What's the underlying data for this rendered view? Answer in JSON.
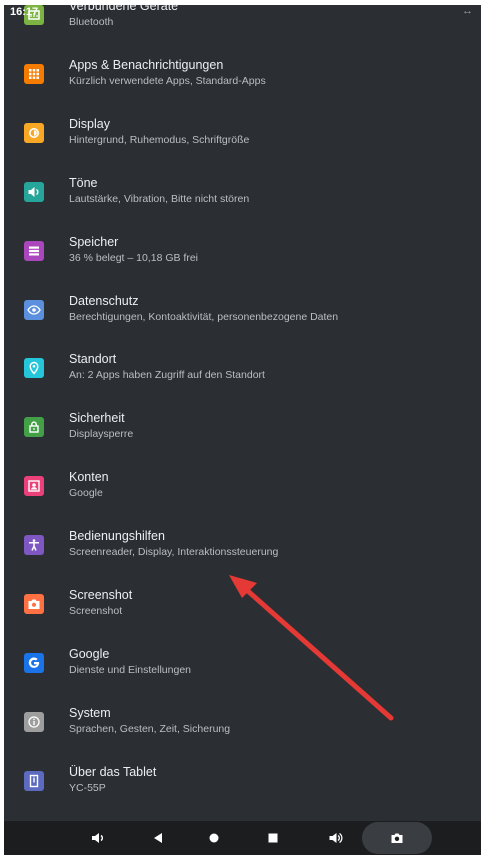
{
  "status_bar": {
    "time": "16:17",
    "rotate_icon": "↔"
  },
  "settings": [
    {
      "title": "Verbundene Geräte",
      "subtitle": "Bluetooth",
      "icon": "connected-devices-icon",
      "color": "#7cb342"
    },
    {
      "title": "Apps & Benachrichtigungen",
      "subtitle": "Kürzlich verwendete Apps, Standard-Apps",
      "icon": "apps-grid-icon",
      "color": "#f57c00"
    },
    {
      "title": "Display",
      "subtitle": "Hintergrund, Ruhemodus, Schriftgröße",
      "icon": "brightness-icon",
      "color": "#f9a825"
    },
    {
      "title": "Töne",
      "subtitle": "Lautstärke, Vibration, Bitte nicht stören",
      "icon": "volume-icon",
      "color": "#26a69a"
    },
    {
      "title": "Speicher",
      "subtitle": "36 % belegt – 10,18 GB frei",
      "icon": "storage-icon",
      "color": "#ab47bc"
    },
    {
      "title": "Datenschutz",
      "subtitle": "Berechtigungen, Kontoaktivität, personenbezogene Daten",
      "icon": "privacy-eye-icon",
      "color": "#5c8fde"
    },
    {
      "title": "Standort",
      "subtitle": "An: 2 Apps haben Zugriff auf den Standort",
      "icon": "location-pin-icon",
      "color": "#26c6da"
    },
    {
      "title": "Sicherheit",
      "subtitle": "Displaysperre",
      "icon": "lock-icon",
      "color": "#43a047"
    },
    {
      "title": "Konten",
      "subtitle": "Google",
      "icon": "account-icon",
      "color": "#ec407a"
    },
    {
      "title": "Bedienungshilfen",
      "subtitle": "Screenreader, Display, Interaktionssteuerung",
      "icon": "accessibility-icon",
      "color": "#7e57c2"
    },
    {
      "title": "Screenshot",
      "subtitle": "Screenshot",
      "icon": "camera-icon",
      "color": "#ff7043"
    },
    {
      "title": "Google",
      "subtitle": "Dienste und Einstellungen",
      "icon": "google-g-icon",
      "color": "#1a73e8"
    },
    {
      "title": "System",
      "subtitle": "Sprachen, Gesten, Zeit, Sicherung",
      "icon": "info-icon",
      "color": "#9e9e9e"
    },
    {
      "title": "Über das Tablet",
      "subtitle": "YC-55P",
      "icon": "tablet-icon",
      "color": "#5c6bc0"
    }
  ],
  "nav_bar": [
    "volume-down-icon",
    "back-icon",
    "home-icon",
    "recents-icon",
    "volume-up-icon",
    "screenshot-camera-icon"
  ],
  "annotation": {
    "color": "#e53935",
    "target": "Bedienungshilfen"
  }
}
